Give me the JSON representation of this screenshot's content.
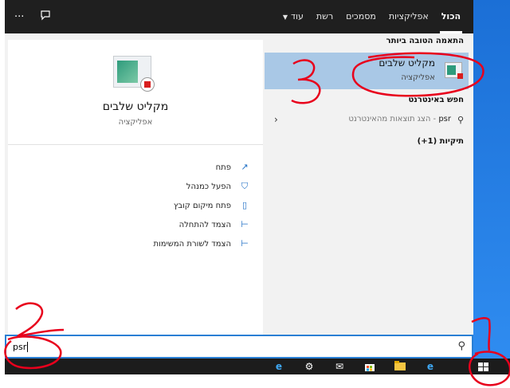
{
  "topbar": {
    "tabs": [
      "הכול",
      "אפליקציות",
      "מסמכים",
      "רשת",
      "עוד"
    ],
    "active_tab": "הכול",
    "icons": [
      "ellipsis-icon",
      "feedback-icon"
    ]
  },
  "preview": {
    "title": "מקליט שלבים",
    "subtitle": "אפליקציה",
    "actions": [
      {
        "label": "פתח",
        "icon": "open-icon"
      },
      {
        "label": "הפעל כמנהל",
        "icon": "shield-icon"
      },
      {
        "label": "פתח מיקום קובץ",
        "icon": "folder-icon"
      },
      {
        "label": "הצמד להתחלה",
        "icon": "pin-icon"
      },
      {
        "label": "הצמד לשורת המשימות",
        "icon": "pin-icon"
      }
    ]
  },
  "results": {
    "best_match_header": "התאמה הטובה ביותר",
    "best_match": {
      "title": "מקליט שלבים",
      "subtitle": "אפליקציה"
    },
    "web_header": "חפש באינטרנט",
    "web_query": "psr",
    "web_suffix": " - הצג תוצאות מהאינטרנט",
    "folders_header": "תיקיות (1+)"
  },
  "search": {
    "value": "psr"
  },
  "taskbar": {
    "icons": [
      "ie-icon",
      "settings-icon",
      "mail-icon",
      "store-icon",
      "explorer-icon",
      "edge-icon",
      "windows-start-icon"
    ]
  },
  "annotations": {
    "label_1": "1",
    "label_2": "2",
    "label_3": "3",
    "color": "#e8001c"
  },
  "colors": {
    "accent": "#2a7fd4",
    "selected": "#a9c8e6",
    "topbar": "#1f1f1f"
  }
}
